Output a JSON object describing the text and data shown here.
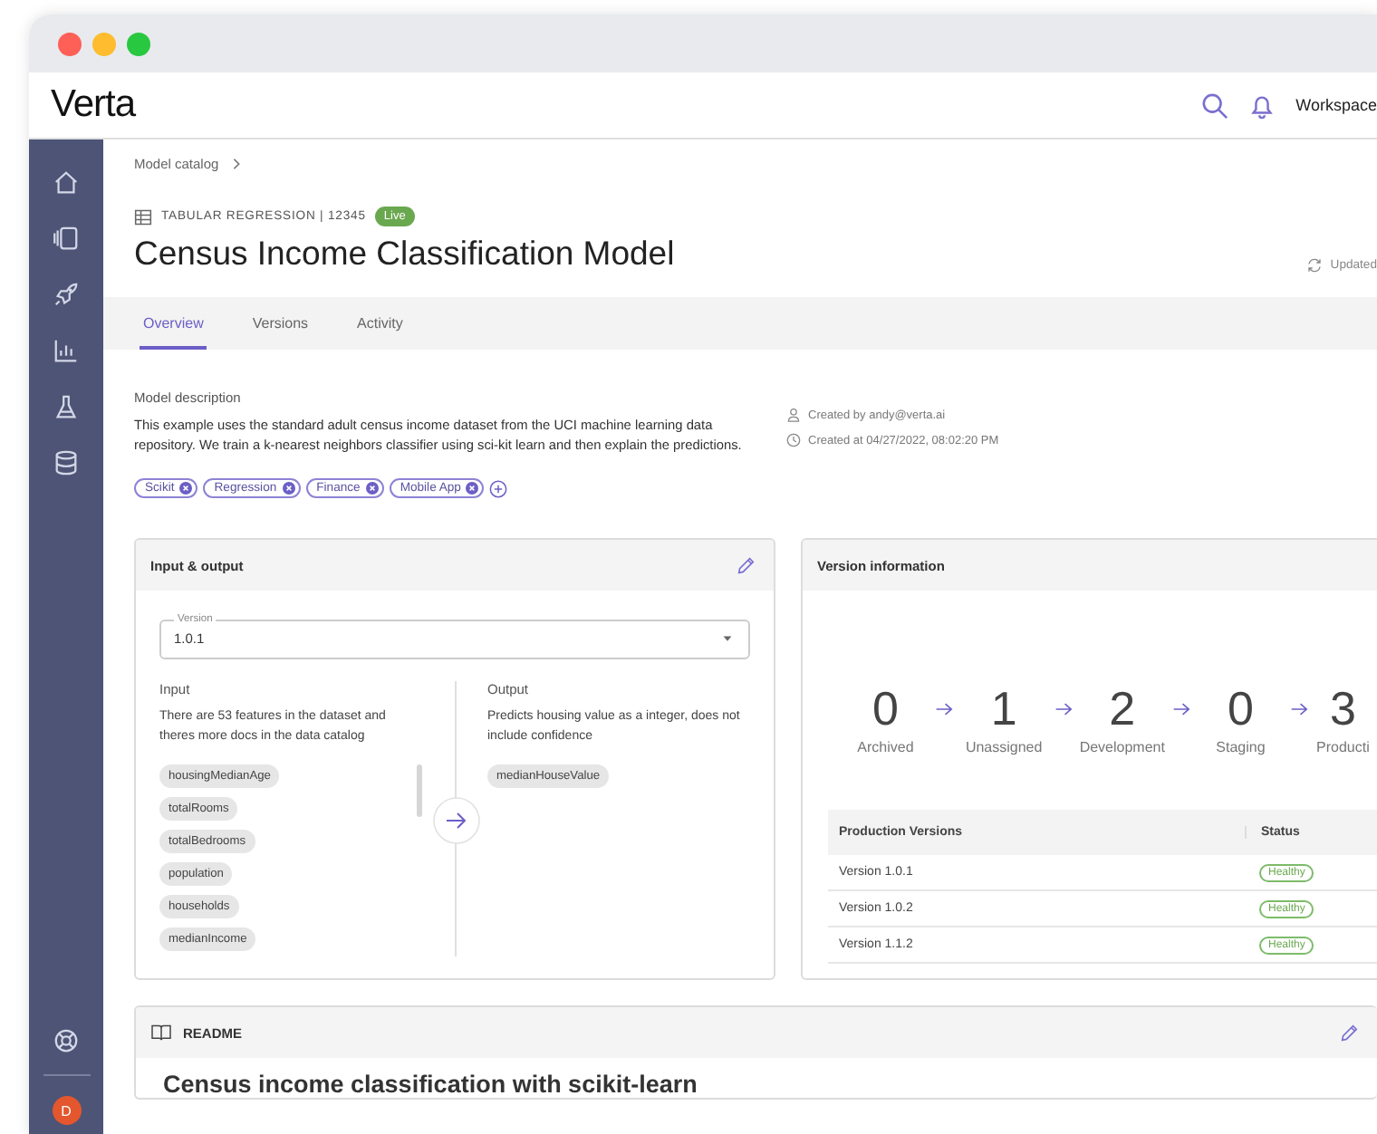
{
  "app": {
    "logo": "Verta",
    "workspace": "Workspace"
  },
  "sidebar": {
    "avatar": "D"
  },
  "breadcrumb": [
    "Model catalog"
  ],
  "model": {
    "type_label": "TABULAR REGRESSION | 12345",
    "status": "Live",
    "title": "Census Income Classification Model",
    "updated": "Updated"
  },
  "tabs": [
    {
      "label": "Overview",
      "selected": true
    },
    {
      "label": "Versions",
      "selected": false
    },
    {
      "label": "Activity",
      "selected": false
    }
  ],
  "description": {
    "label": "Model description",
    "text": "This example uses the standard adult census income dataset from the UCI machine learning data repository. We train a k-nearest neighbors classifier using sci-kit learn and then explain the predictions.",
    "created_by": "Created by andy@verta.ai",
    "created_at": "Created at 04/27/2022, 08:02:20 PM"
  },
  "tags": [
    "Scikit",
    "Regression",
    "Finance",
    "Mobile App"
  ],
  "input_output": {
    "title": "Input & output",
    "version_label": "Version",
    "version_value": "1.0.1",
    "input": {
      "heading": "Input",
      "text": "There are 53 features in the dataset and theres more docs in the data catalog",
      "features": [
        "housingMedianAge",
        "totalRooms",
        "totalBedrooms",
        "population",
        "households",
        "medianIncome"
      ]
    },
    "output": {
      "heading": "Output",
      "text": "Predicts housing value as a integer, does not include confidence",
      "features": [
        "medianHouseValue"
      ]
    }
  },
  "version_information": {
    "title": "Version information",
    "stages": [
      {
        "count": "0",
        "label": "Archived"
      },
      {
        "count": "1",
        "label": "Unassigned"
      },
      {
        "count": "2",
        "label": "Development"
      },
      {
        "count": "0",
        "label": "Staging"
      },
      {
        "count": "3",
        "label": "Producti"
      }
    ],
    "columns": [
      "Production Versions",
      "Status"
    ],
    "rows": [
      {
        "version": "Version 1.0.1",
        "status": "Healthy"
      },
      {
        "version": "Version 1.0.2",
        "status": "Healthy"
      },
      {
        "version": "Version 1.1.2",
        "status": "Healthy"
      }
    ]
  },
  "readme": {
    "title": "README",
    "heading": "Census income classification with scikit-learn"
  }
}
